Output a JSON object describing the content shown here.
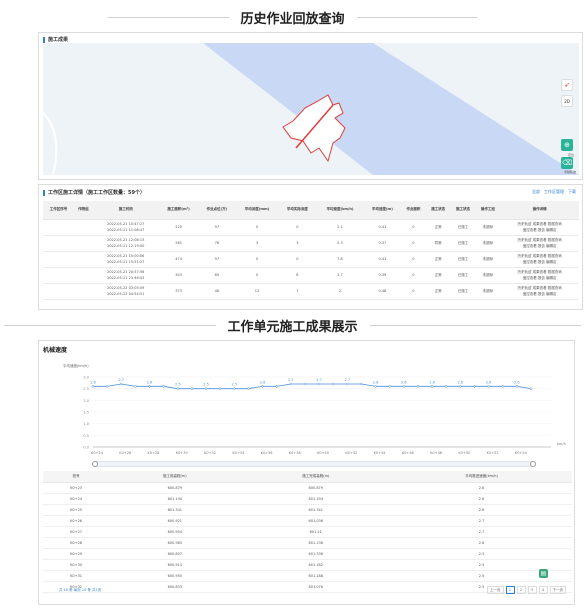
{
  "section1_title": "历史作业回放查询",
  "section2_title": "工作单元施工成果展示",
  "map_panel": {
    "title": "施工成果",
    "tools": [
      {
        "icon": "compass-icon",
        "label": ""
      },
      {
        "icon": "layer-icon",
        "label": "2D"
      },
      {
        "icon": "locate-icon",
        "label": "定位"
      },
      {
        "icon": "trash-icon",
        "label": "清除轨迹"
      }
    ]
  },
  "work_table": {
    "title": "工作区施工详情（施工工作区数量：59个）",
    "actions": [
      "全部",
      "工作区管理",
      "下载"
    ],
    "columns": [
      "工作区序号",
      "作物组",
      "施工时间",
      "施工面积(m²)",
      "作业点位(万)",
      "平均深度(mm)",
      "平均实际深度",
      "平均速度(km/h)",
      "平均速度(m)",
      "作业面积",
      "施工状态",
      "施工状态",
      "操作工班",
      "操作详情"
    ],
    "rows": [
      {
        "time1": "2022-05-21 10:47:27",
        "time2": "2022-05-21 11:08:47",
        "c3": "220",
        "c4": "97",
        "c5": "0",
        "c6": "0",
        "c7": "2.1",
        "c8": "0.41",
        "c9": "0",
        "status": "正常",
        "status_red": false,
        "s2": "已施工",
        "s3": "未超标",
        "ops1": "历史轨迹  成果查看  数据查询",
        "ops2": "遥控查看  报告  编辑区"
      },
      {
        "time1": "2022-05-21 12:08:13",
        "time2": "2022-05-21 12:19:00",
        "c3": "261",
        "c4": "78",
        "c5": "3",
        "c6": "3",
        "c7": "2.3",
        "c8": "0.37",
        "c9": "0",
        "status": "异常",
        "status_red": true,
        "s2": "已施工",
        "s3": "未超标",
        "ops1": "历史轨迹  成果查看  数据查询",
        "ops2": "遥控查看  报告  编辑区"
      },
      {
        "time1": "2022-05-21 15:00:06",
        "time2": "2022-05-21 15:51:27",
        "c3": "474",
        "c4": "97",
        "c5": "0",
        "c6": "0",
        "c7": "7.8",
        "c8": "0.41",
        "c9": "0",
        "status": "正常",
        "status_red": false,
        "s2": "已施工",
        "s3": "未超标",
        "ops1": "历史轨迹  成果查看  数据查询",
        "ops2": "遥控查看  报告  编辑区"
      },
      {
        "time1": "2022-05-21 20:57:56",
        "time2": "2022-05-21 23:46:03",
        "c3": "343",
        "c4": "69",
        "c5": "0",
        "c6": "6",
        "c7": "2.7",
        "c8": "0.39",
        "c9": "0",
        "status": "正常",
        "status_red": false,
        "s2": "已施工",
        "s3": "未超标",
        "ops1": "历史轨迹  成果查看  数据查询",
        "ops2": "遥控查看  报告  编辑区"
      },
      {
        "time1": "2022-05-22 03:05:09",
        "time2": "2022-05-22 04:54:51",
        "c3": "373",
        "c4": "48",
        "c5": "12",
        "c6": "7",
        "c7": "2",
        "c8": "0.48",
        "c9": "0",
        "status": "正常",
        "status_red": false,
        "s2": "已施工",
        "s3": "未超标",
        "ops1": "历史轨迹  成果查看  数据查询",
        "ops2": "遥控查看  报告  编辑区"
      }
    ]
  },
  "speed_panel": {
    "title": "机械速度",
    "unit_label": "平均速度(km/h)",
    "x_unit": "km/h"
  },
  "chart_data": {
    "type": "line",
    "title": "",
    "ylabel": "平均速度(km/h)",
    "xlabel": "",
    "ylim": [
      0,
      3.0
    ],
    "yticks": [
      0,
      0.5,
      1.0,
      1.5,
      2.0,
      2.5,
      3.0
    ],
    "x": [
      "K0+24",
      "K0+25",
      "K0+26",
      "K0+27",
      "K0+28",
      "K0+29",
      "K0+30",
      "K0+31",
      "K0+32",
      "K0+33",
      "K0+34",
      "K0+35",
      "K0+36",
      "K0+37",
      "K0+38",
      "K0+39",
      "K0+40",
      "K0+41",
      "K0+42",
      "K0+43",
      "K0+44",
      "K0+45",
      "K0+46",
      "K0+47",
      "K0+48",
      "K0+49",
      "K0+50",
      "K0+51",
      "K0+52",
      "K0+53",
      "K0+54",
      "K0+55"
    ],
    "xticks": [
      "K0+24",
      "K0+26",
      "K0+28",
      "K0+30",
      "K0+32",
      "K0+34",
      "K0+36",
      "K0+38",
      "K0+40",
      "K0+42",
      "K0+44",
      "K0+46",
      "K0+48",
      "K0+50",
      "K0+52",
      "K0+54"
    ],
    "series": [
      {
        "name": "",
        "values": [
          2.6,
          2.6,
          2.7,
          2.6,
          2.6,
          2.6,
          2.5,
          2.5,
          2.5,
          2.5,
          2.5,
          2.5,
          2.6,
          2.6,
          2.7,
          2.7,
          2.7,
          2.7,
          2.7,
          2.7,
          2.6,
          2.6,
          2.6,
          2.6,
          2.6,
          2.6,
          2.6,
          2.6,
          2.6,
          2.6,
          2.6,
          2.5
        ]
      }
    ],
    "point_labels": [
      "2.6",
      "2.7",
      "2.6",
      "2.5",
      "2.5",
      "2.5",
      "2.6",
      "2.7",
      "2.7",
      "2.7",
      "2.6",
      "2.6",
      "2.6",
      "2.6",
      "2.6",
      "2.6"
    ],
    "grid": true
  },
  "speed_table": {
    "columns": [
      "桩号",
      "施工前高程(m)",
      "施工完成高程(m)",
      "平均推进速度(km/h)"
    ],
    "rows": [
      [
        "K0+23",
        "600.879",
        "600.879",
        "2.6"
      ],
      [
        "K0+24",
        "601.194",
        "601.194",
        "2.6"
      ],
      [
        "K0+25",
        "601.341",
        "601.341",
        "2.6"
      ],
      [
        "K0+26",
        "600.921",
        "601.036",
        "2.7"
      ],
      [
        "K0+27",
        "600.954",
        "601.21",
        "2.7"
      ],
      [
        "K0+28",
        "600.983",
        "601.136",
        "2.6"
      ],
      [
        "K0+29",
        "600.807",
        "601.336",
        "2.5"
      ],
      [
        "K0+30",
        "600.914",
        "601.182",
        "2.5"
      ],
      [
        "K0+31",
        "600.950",
        "601.188",
        "2.5"
      ],
      [
        "K0+32",
        "600.833",
        "601.076",
        "2.5"
      ]
    ],
    "footer": "共 10 条  每页 10 条  共1页",
    "pager": [
      "上一页",
      "1",
      "2",
      "3",
      "4",
      "下一页"
    ]
  },
  "colors": {
    "accent": "#2f7fd8",
    "map_band": "#c9d9f5",
    "line": "#4a8fe0",
    "boundary": "#e03c3c"
  }
}
